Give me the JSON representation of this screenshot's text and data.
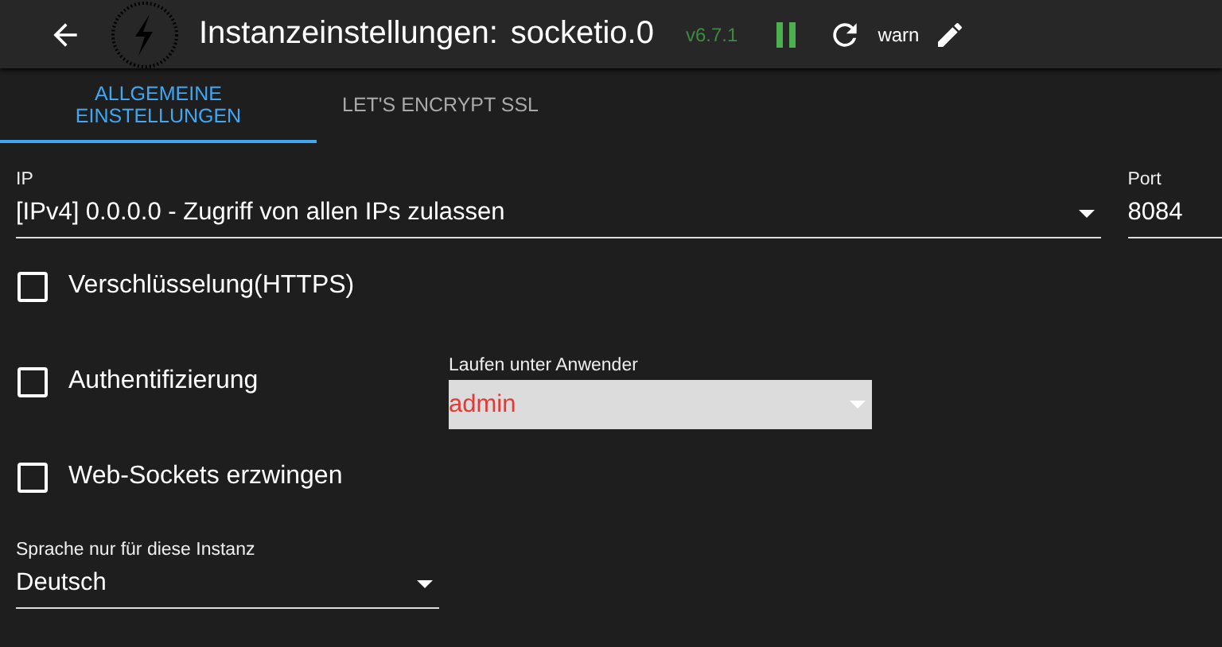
{
  "header": {
    "title": "Instanzeinstellungen:",
    "instance": "socketio.0",
    "version": "v6.7.1",
    "log_level": "warn"
  },
  "tabs": [
    {
      "label": "ALLGEMEINE EINSTELLUNGEN",
      "selected": true
    },
    {
      "label": "LET'S ENCRYPT SSL",
      "selected": false
    }
  ],
  "ip": {
    "label": "IP",
    "value": "[IPv4] 0.0.0.0 - Zugriff von allen IPs zulassen"
  },
  "port": {
    "label": "Port",
    "value": "8084"
  },
  "options": [
    {
      "label": "Verschlüsselung(HTTPS)",
      "checked": false
    },
    {
      "label": "Authentifizierung",
      "checked": false
    },
    {
      "label": "Web-Sockets erzwingen",
      "checked": false
    }
  ],
  "run_as": {
    "label": "Laufen unter Anwender",
    "value": "admin",
    "disabled": true
  },
  "language": {
    "label": "Sprache nur für diese Instanz",
    "value": "Deutsch"
  }
}
